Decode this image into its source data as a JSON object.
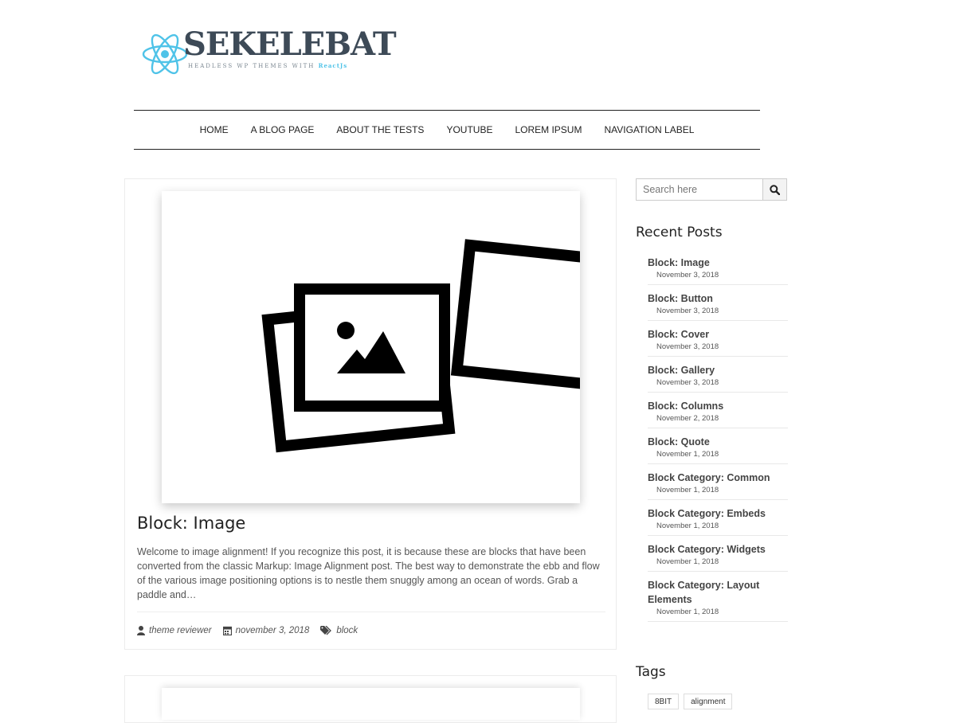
{
  "header": {
    "logo_word": "SEKELEBAT",
    "logo_tagline_prefix": "HEADLESS WP THEMES WITH",
    "logo_tagline_accent": "ReactJs"
  },
  "nav": {
    "items": [
      "HOME",
      "A BLOG PAGE",
      "ABOUT THE TESTS",
      "YOUTUBE",
      "LOREM IPSUM",
      "NAVIGATION LABEL"
    ]
  },
  "post": {
    "title": "Block: Image",
    "excerpt": "Welcome to image alignment! If you recognize this post, it is because these are blocks that have been converted from the classic Markup: Image Alignment post. The best way to demonstrate the ebb and flow of the various image positioning options is to nestle them snuggly among an ocean of words. Grab a paddle and…",
    "author": "theme reviewer",
    "date": "november 3, 2018",
    "category": "block"
  },
  "sidebar": {
    "search_placeholder": "Search here",
    "recent_heading": "Recent Posts",
    "recent": [
      {
        "title": "Block: Image",
        "date": "November 3, 2018"
      },
      {
        "title": "Block: Button",
        "date": "November 3, 2018"
      },
      {
        "title": "Block: Cover",
        "date": "November 3, 2018"
      },
      {
        "title": "Block: Gallery",
        "date": "November 3, 2018"
      },
      {
        "title": "Block: Columns",
        "date": "November 2, 2018"
      },
      {
        "title": "Block: Quote",
        "date": "November 1, 2018"
      },
      {
        "title": "Block Category: Common",
        "date": "November 1, 2018"
      },
      {
        "title": "Block Category: Embeds",
        "date": "November 1, 2018"
      },
      {
        "title": "Block Category: Widgets",
        "date": "November 1, 2018"
      },
      {
        "title": "Block Category: Layout Elements",
        "date": "November 1, 2018"
      }
    ],
    "tags_heading": "Tags",
    "tags": [
      "8BIT",
      "alignment"
    ]
  },
  "colors": {
    "logo_accent": "#4fc3e8",
    "logo_text": "#3d4a57",
    "text": "#222222"
  }
}
